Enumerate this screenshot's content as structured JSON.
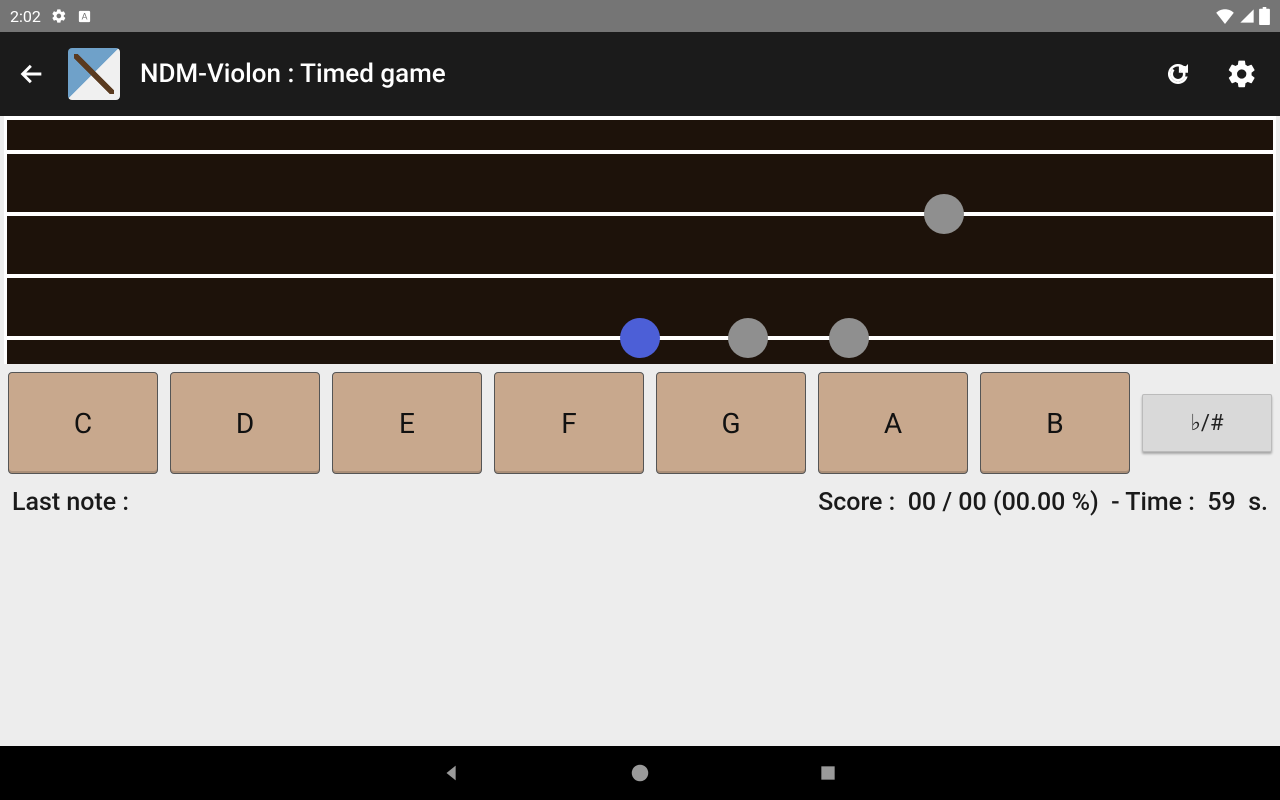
{
  "status_bar": {
    "time": "2:02"
  },
  "app_bar": {
    "title": "NDM-Violon : Timed game"
  },
  "fretboard": {
    "strings_y": [
      30,
      92,
      154,
      216
    ],
    "dots": [
      {
        "x_pct": 74.0,
        "string_index": 1,
        "color": "grey"
      },
      {
        "x_pct": 50.0,
        "string_index": 3,
        "color": "blue"
      },
      {
        "x_pct": 58.5,
        "string_index": 3,
        "color": "grey"
      },
      {
        "x_pct": 66.5,
        "string_index": 3,
        "color": "grey"
      }
    ]
  },
  "notes": [
    "C",
    "D",
    "E",
    "F",
    "G",
    "A",
    "B"
  ],
  "accidental_label": "♭/#",
  "status": {
    "last_note_label": "Last note :",
    "last_note_value": "",
    "score_label": "Score :",
    "score_value": "00 / 00 (00.00 %)",
    "time_label": "- Time :",
    "time_value": "59",
    "time_unit": "s."
  }
}
